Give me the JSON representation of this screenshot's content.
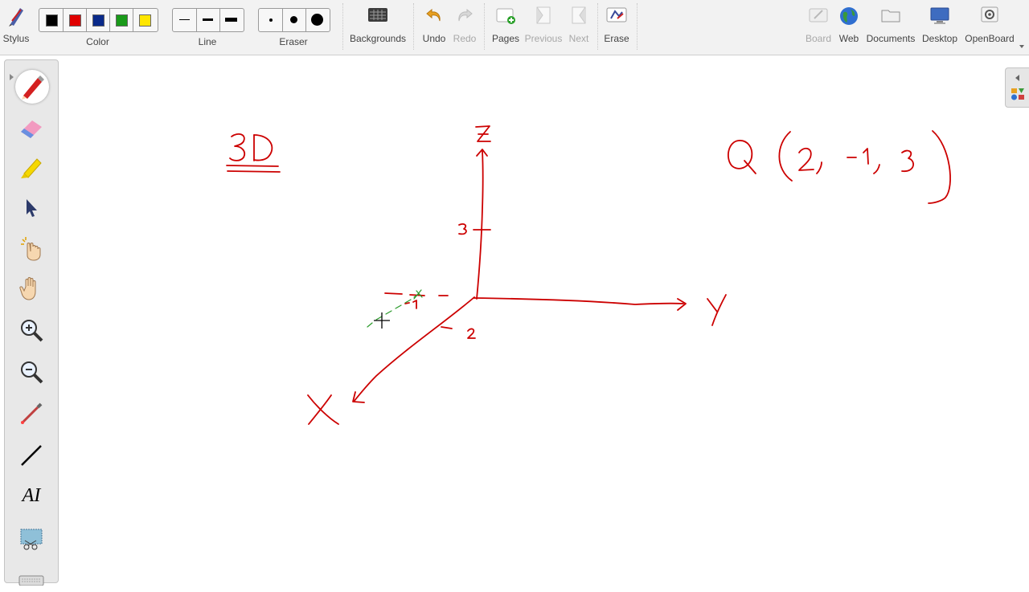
{
  "toolbar": {
    "stylus_label": "Stylus",
    "color_label": "Color",
    "line_label": "Line",
    "eraser_label": "Eraser",
    "backgrounds_label": "Backgrounds",
    "undo_label": "Undo",
    "redo_label": "Redo",
    "pages_label": "Pages",
    "previous_label": "Previous",
    "next_label": "Next",
    "erase_label": "Erase",
    "board_label": "Board",
    "web_label": "Web",
    "documents_label": "Documents",
    "desktop_label": "Desktop",
    "openboard_label": "OpenBoard",
    "colors": [
      "#000000",
      "#e00000",
      "#0a2a8a",
      "#1a9a1a",
      "#ffe600"
    ],
    "selected_color": "#e00000",
    "line_widths": [
      "thin",
      "medium",
      "thick"
    ],
    "eraser_sizes": [
      "small",
      "medium",
      "large"
    ]
  },
  "palette": {
    "tools": [
      "pen-icon",
      "eraser-icon",
      "highlighter-icon",
      "selector-icon",
      "interactor-icon",
      "hand-icon",
      "zoom-in-icon",
      "zoom-out-icon",
      "laser-pointer-icon",
      "line-icon",
      "text-icon",
      "capture-icon",
      "keyboard-icon"
    ],
    "text_tool_glyph": "AI",
    "active_tool": "pen-icon"
  },
  "board": {
    "ink_color": "#cc0000",
    "green_ink_color": "#2a9a2a",
    "title_3d": "3D",
    "point_label": "Q (2, -1, 3)",
    "axis_z": "Z",
    "axis_y": "Y",
    "axis_x": "X",
    "tick_3": "3",
    "tick_2": "2",
    "tick_neg1": "-1"
  }
}
